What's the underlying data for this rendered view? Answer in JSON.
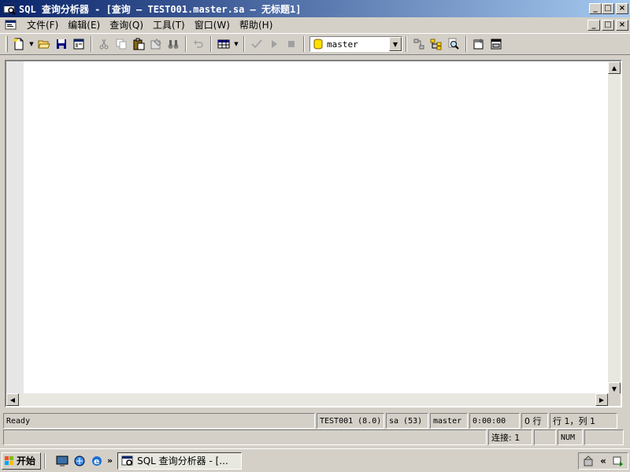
{
  "window": {
    "title": "SQL 查询分析器 - [查询 — TEST001.master.sa — 无标题1]",
    "minimize": "_",
    "restore": "□",
    "close": "×"
  },
  "menu": {
    "items": [
      "文件(F)",
      "编辑(E)",
      "查询(Q)",
      "工具(T)",
      "窗口(W)",
      "帮助(H)"
    ]
  },
  "toolbar": {
    "database_selected": "master"
  },
  "statusbar": {
    "ready": "Ready",
    "server": "TEST001 (8.0)",
    "user": "sa (53)",
    "database": "master",
    "time": "0:00:00",
    "rows": "0 行",
    "position": "行 1，列 1",
    "connections": "连接: 1",
    "num": "NUM"
  },
  "taskbar": {
    "start_label": "开始",
    "task_label": "SQL 查询分析器 - [...",
    "chevron_quick": "»",
    "chevron_tray": "«"
  },
  "colors": {
    "title_start": "#0a246a",
    "title_end": "#a6caf0",
    "face": "#d4d0c8"
  }
}
